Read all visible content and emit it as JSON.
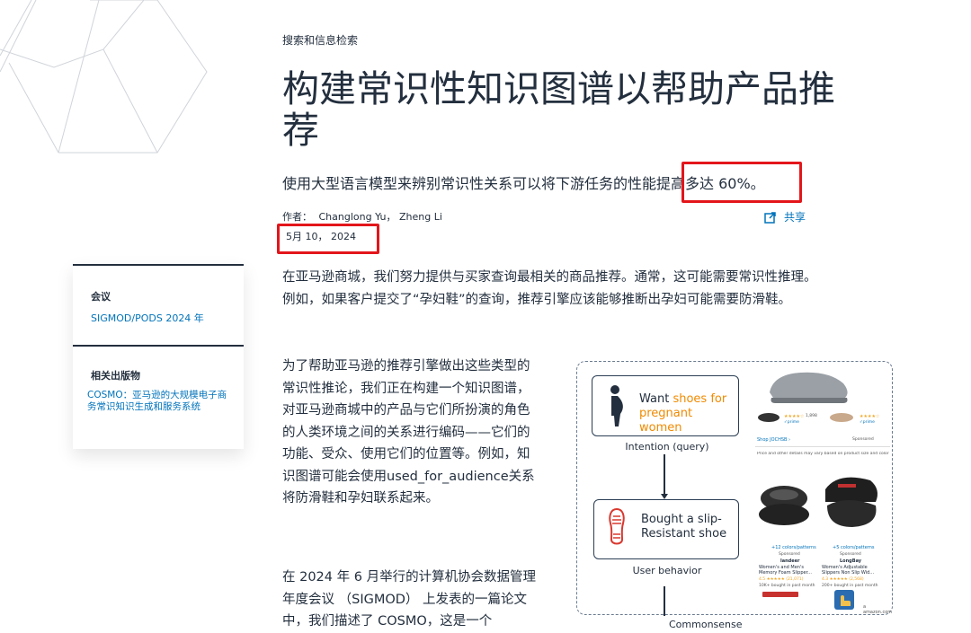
{
  "category": "搜索和信息检索",
  "title": "构建常识性知识图谱以帮助产品推荐",
  "subtitle": "使用大型语言模型来辨别常识性关系可以将下游任务的性能提高多达 60%。",
  "authors": {
    "label": "作者：",
    "names": "Changlong Yu， Zheng Li"
  },
  "date": "5月 10， 2024",
  "share_label": "共享",
  "sidebar": {
    "conference_label": "会议",
    "conference_link": "SIGMOD/PODS 2024 年",
    "related_label": "相关出版物",
    "related_link": "COSMO：亚马逊的大规模电子商务常识知识生成和服务系统"
  },
  "body": {
    "p1": "在亚马逊商城，我们努力提供与买家查询最相关的商品推荐。通常，这可能需要常识性推理。例如，如果客户提交了“孕妇鞋”的查询，推荐引擎应该能够推断出孕妇可能需要防滑鞋。",
    "p2": "为了帮助亚马逊的推荐引擎做出这些类型的常识性推论，我们正在构建一个知识图谱，对亚马逊商城中的产品与它们所扮演的角色的人类环境之间的关系进行编码——它们的功能、受众、使用它们的位置等。例如，知识图谱可能会使用used_for_audience关系将防滑鞋和孕妇联系起来。",
    "p3": "在 2024 年 6 月举行的计算机协会数据管理年度会议 （SIGMOD） 上发表的一篇论文中，我们描述了 COSMO，这是一个"
  },
  "figure": {
    "box1_prefix": "Want ",
    "box1_accent": "shoes for pregnant women",
    "caption1": "Intention (query)",
    "box2_text": "Bought a slip-Resistant shoe",
    "caption2": "User behavior",
    "caption3": "Commonsense",
    "shop": {
      "rating1": "1,898",
      "prime": "✓prime",
      "shop_link": "Shop JOCHSB ›",
      "sponsored": "Sponsored",
      "price_note": "Price and other details may vary based on product size and color",
      "brand_link1": "+12 colors/patterns",
      "brand_link2": "+5 colors/patterns",
      "product1_brand": "landeer",
      "product1_name": "Women's and Men's Memory Foam Slipper...",
      "product1_rating": "4.5 ★★★★★ (21,071)",
      "product1_bought": "10K+ bought in past month",
      "product2_brand": "LongBay",
      "product2_name": "Women's Adjustable Slippers Non Slip Wid...",
      "product2_rating": "4.3 ★★★★★ (2,568)",
      "product2_bought": "200+ bought in past month",
      "amazon": "a amazon.com"
    }
  },
  "colors": {
    "link": "#0073bb",
    "text": "#232f3e",
    "highlight": "#e3161b",
    "accent": "#f08a00"
  }
}
